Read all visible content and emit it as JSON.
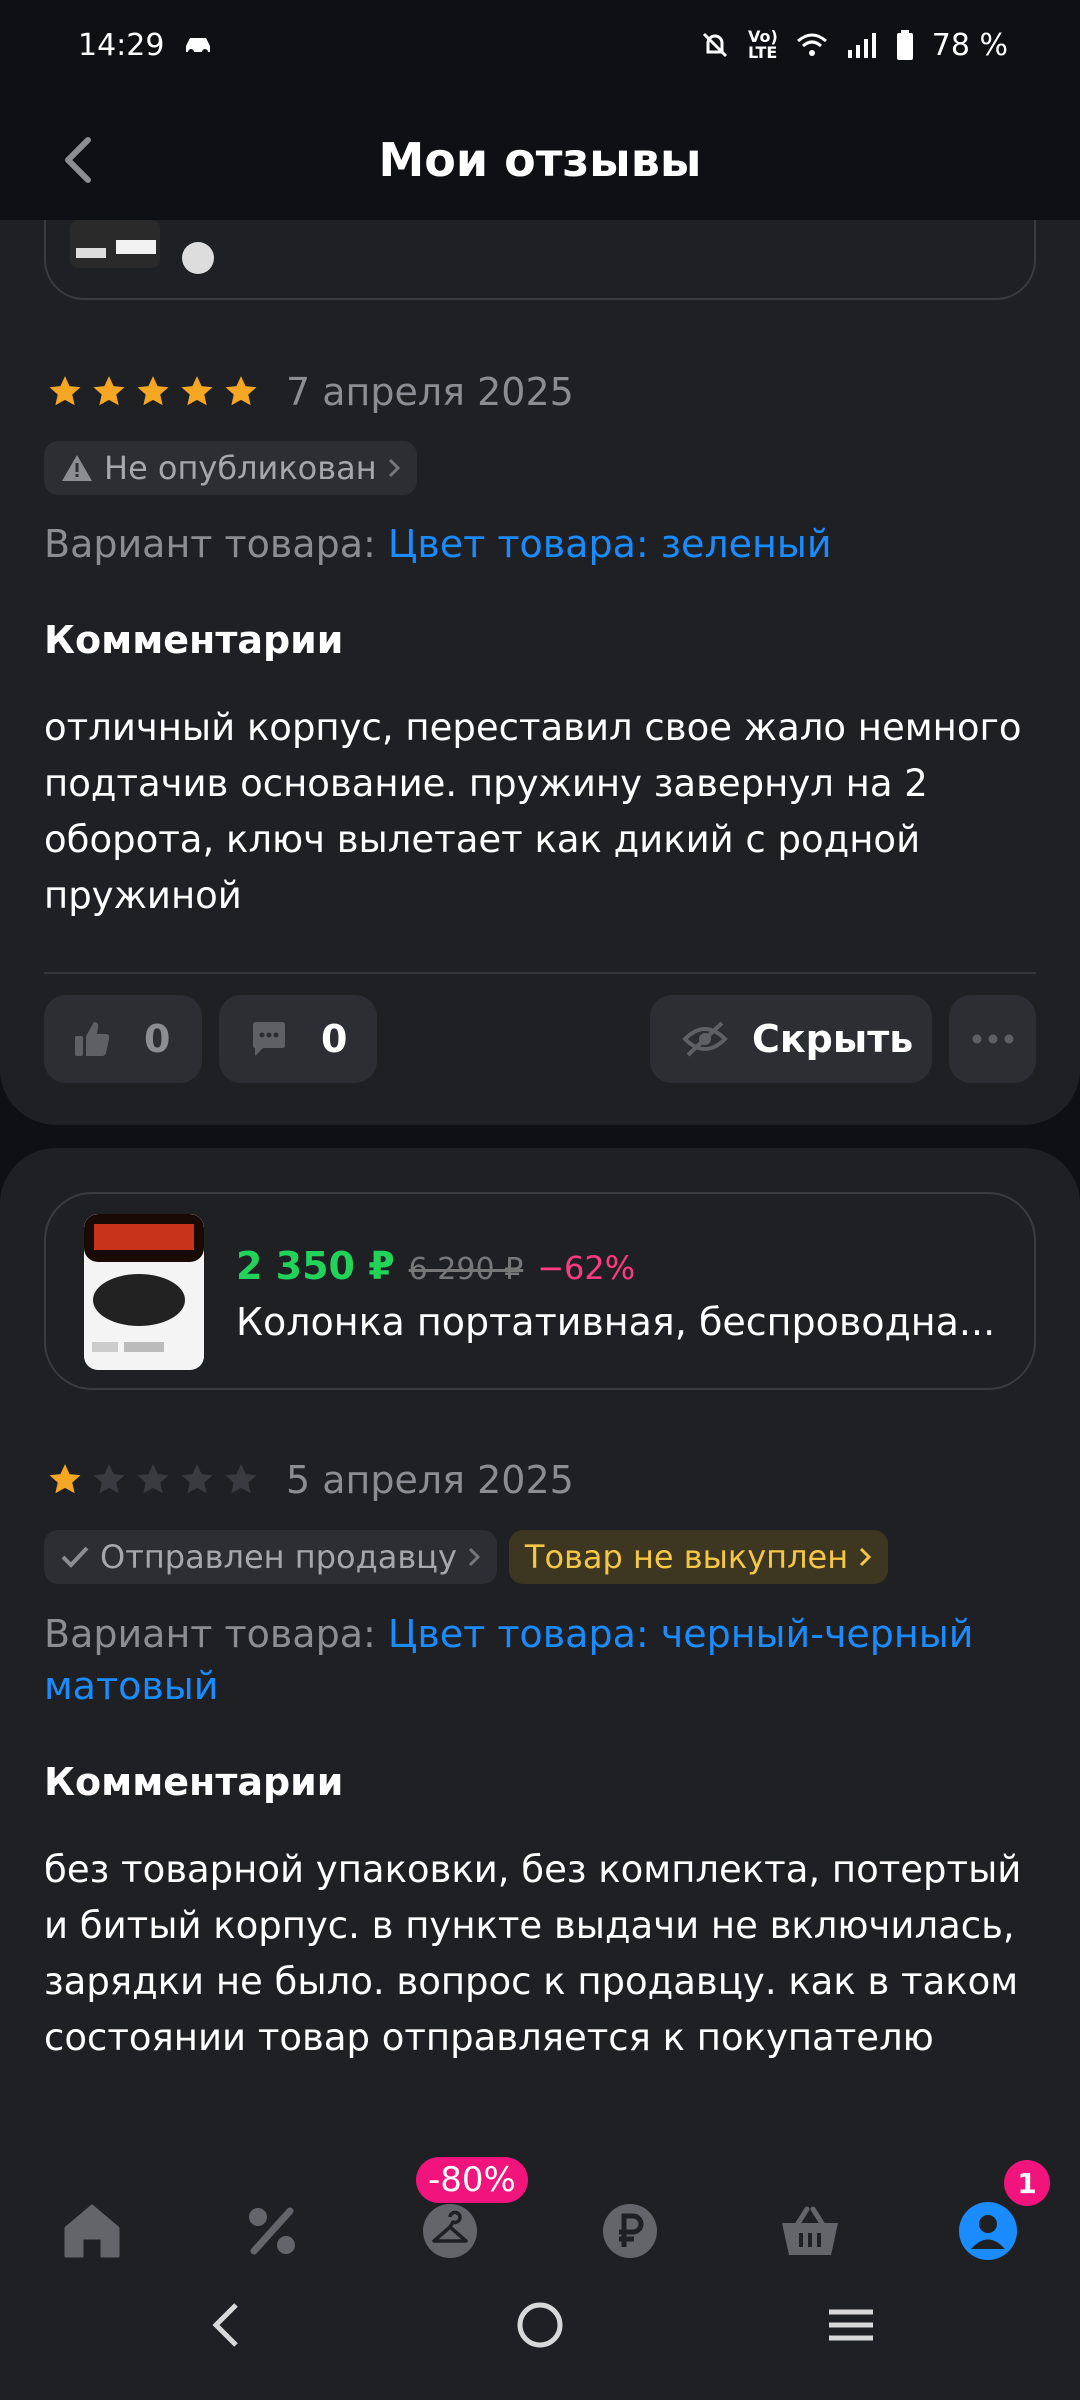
{
  "status_bar": {
    "time": "14:29",
    "battery": "78 %"
  },
  "header": {
    "title": "Мои отзывы"
  },
  "review1": {
    "stars": 5,
    "date": "7 апреля 2025",
    "status": "Не опубликован",
    "variant_label": "Вариант товара:",
    "variant_value": "Цвет товара: зеленый",
    "comment_title": "Комментарии",
    "comment": "отличный корпус, переставил свое жало немного подтачив основание. пружину завернул на 2 оборота, ключ вылетает как дикий с родной пружиной",
    "likes": "0",
    "comments_count": "0",
    "hide_label": "Скрыть"
  },
  "review2": {
    "product": {
      "price": "2 350 ₽",
      "old_price": "6 290 ₽",
      "discount": "−62%",
      "name": "Колонка портативная, беспроводна..."
    },
    "stars": 1,
    "date": "5 апреля 2025",
    "status": "Отправлен продавцу",
    "status2": "Товар не выкуплен",
    "variant_label": "Вариант товара:",
    "variant_value": "Цвет товара: черный-черный матовый",
    "comment_title": "Комментарии",
    "comment": "без товарной упаковки, без комплекта, потертый и битый корпус. в пункте выдачи не включилась, зарядки не было. вопрос к продавцу. как в таком состоянии товар отправляется к покупателю"
  },
  "bottom_nav": {
    "items": [
      "home-icon",
      "discount-icon",
      "clothes-icon",
      "ruble-icon",
      "basket-icon",
      "profile-icon"
    ],
    "promo_badge": "-80%",
    "profile_badge": "1"
  },
  "colors": {
    "accent_blue": "#1a8cff",
    "star": "#f5a623",
    "price_green": "#22d35a",
    "discount_pink": "#ff3b7f",
    "badge_pink": "#f0147c"
  }
}
